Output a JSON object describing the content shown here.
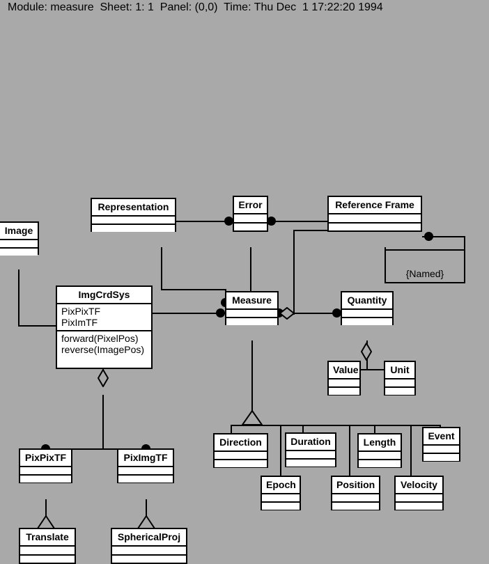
{
  "header": {
    "text": "Module: measure  Sheet: 1: 1  Panel: (0,0)  Time: Thu Dec  1 17:22:20 1994",
    "module_label": "Module:",
    "module_value": "measure",
    "sheet_label": "Sheet:",
    "sheet_value": "1: 1",
    "panel_label": "Panel:",
    "panel_value": "(0,0)",
    "time_label": "Time:",
    "time_value": "Thu Dec  1 17:22:20 1994"
  },
  "colors": {
    "background": "#a9a9a9",
    "box_fill": "#ffffff",
    "line": "#000000",
    "text": "#000000"
  },
  "diagram": {
    "title": "measure",
    "notation": "OMT class diagram",
    "classes": [
      {
        "id": "image",
        "name": "Image",
        "attributes": [],
        "operations": []
      },
      {
        "id": "representation",
        "name": "Representation",
        "attributes": [],
        "operations": []
      },
      {
        "id": "error",
        "name": "Error",
        "attributes": [],
        "operations": []
      },
      {
        "id": "referenceframe",
        "name": "Reference Frame",
        "attributes": [],
        "operations": []
      },
      {
        "id": "imgcrdsys",
        "name": "ImgCrdSys",
        "attributes": [
          "PixPixTF",
          "PixImTF"
        ],
        "operations": [
          "forward(PixelPos)",
          "reverse(ImagePos)"
        ]
      },
      {
        "id": "measure",
        "name": "Measure",
        "attributes": [],
        "operations": []
      },
      {
        "id": "quantity",
        "name": "Quantity",
        "attributes": [],
        "operations": []
      },
      {
        "id": "value",
        "name": "Value",
        "attributes": [],
        "operations": []
      },
      {
        "id": "unit",
        "name": "Unit",
        "attributes": [],
        "operations": []
      },
      {
        "id": "pixpixtf",
        "name": "PixPixTF",
        "attributes": [],
        "operations": []
      },
      {
        "id": "piximgtf",
        "name": "PixImgTF",
        "attributes": [],
        "operations": []
      },
      {
        "id": "translate",
        "name": "Translate",
        "attributes": [],
        "operations": []
      },
      {
        "id": "sphericalproj",
        "name": "SphericalProj",
        "attributes": [],
        "operations": []
      },
      {
        "id": "direction",
        "name": "Direction",
        "attributes": [],
        "operations": []
      },
      {
        "id": "epoch",
        "name": "Epoch",
        "attributes": [],
        "operations": []
      },
      {
        "id": "duration",
        "name": "Duration",
        "attributes": [],
        "operations": []
      },
      {
        "id": "position",
        "name": "Position",
        "attributes": [],
        "operations": []
      },
      {
        "id": "length",
        "name": "Length",
        "attributes": [],
        "operations": []
      },
      {
        "id": "velocity",
        "name": "Velocity",
        "attributes": [],
        "operations": []
      },
      {
        "id": "event",
        "name": "Event",
        "attributes": [],
        "operations": []
      }
    ],
    "annotations": [
      {
        "id": "named",
        "text": "{Named}",
        "attached_to": "referenceframe"
      }
    ],
    "relationships": [
      {
        "from": "representation",
        "to": "error",
        "type": "association",
        "to_multiplicity": "many"
      },
      {
        "from": "error",
        "to": "referenceframe",
        "type": "association",
        "from_multiplicity": "many"
      },
      {
        "from": "error",
        "to": "measure",
        "type": "association",
        "to_multiplicity": "many"
      },
      {
        "from": "representation",
        "to": "measure",
        "type": "association",
        "to_multiplicity": "many"
      },
      {
        "from": "referenceframe",
        "to": "measure",
        "type": "association",
        "to_multiplicity": "many"
      },
      {
        "from": "referenceframe",
        "to": "referenceframe",
        "type": "association",
        "to_multiplicity": "many"
      },
      {
        "from": "image",
        "to": "imgcrdsys",
        "type": "association"
      },
      {
        "from": "imgcrdsys",
        "to": "measure",
        "type": "association",
        "to_multiplicity": "many"
      },
      {
        "from": "measure",
        "to": "quantity",
        "type": "aggregation",
        "to_multiplicity": "many"
      },
      {
        "from": "quantity",
        "to": "value",
        "type": "aggregation"
      },
      {
        "from": "quantity",
        "to": "unit",
        "type": "aggregation"
      },
      {
        "from": "imgcrdsys",
        "to": "pixpixtf",
        "type": "aggregation",
        "to_multiplicity": "many"
      },
      {
        "from": "imgcrdsys",
        "to": "piximgtf",
        "type": "aggregation",
        "to_multiplicity": "many"
      },
      {
        "from": "pixpixtf",
        "to": "translate",
        "type": "generalization"
      },
      {
        "from": "piximgtf",
        "to": "sphericalproj",
        "type": "generalization"
      },
      {
        "from": "measure",
        "to": "direction",
        "type": "generalization"
      },
      {
        "from": "measure",
        "to": "epoch",
        "type": "generalization"
      },
      {
        "from": "measure",
        "to": "duration",
        "type": "generalization"
      },
      {
        "from": "measure",
        "to": "position",
        "type": "generalization"
      },
      {
        "from": "measure",
        "to": "length",
        "type": "generalization"
      },
      {
        "from": "measure",
        "to": "velocity",
        "type": "generalization"
      },
      {
        "from": "measure",
        "to": "event",
        "type": "generalization"
      }
    ]
  }
}
